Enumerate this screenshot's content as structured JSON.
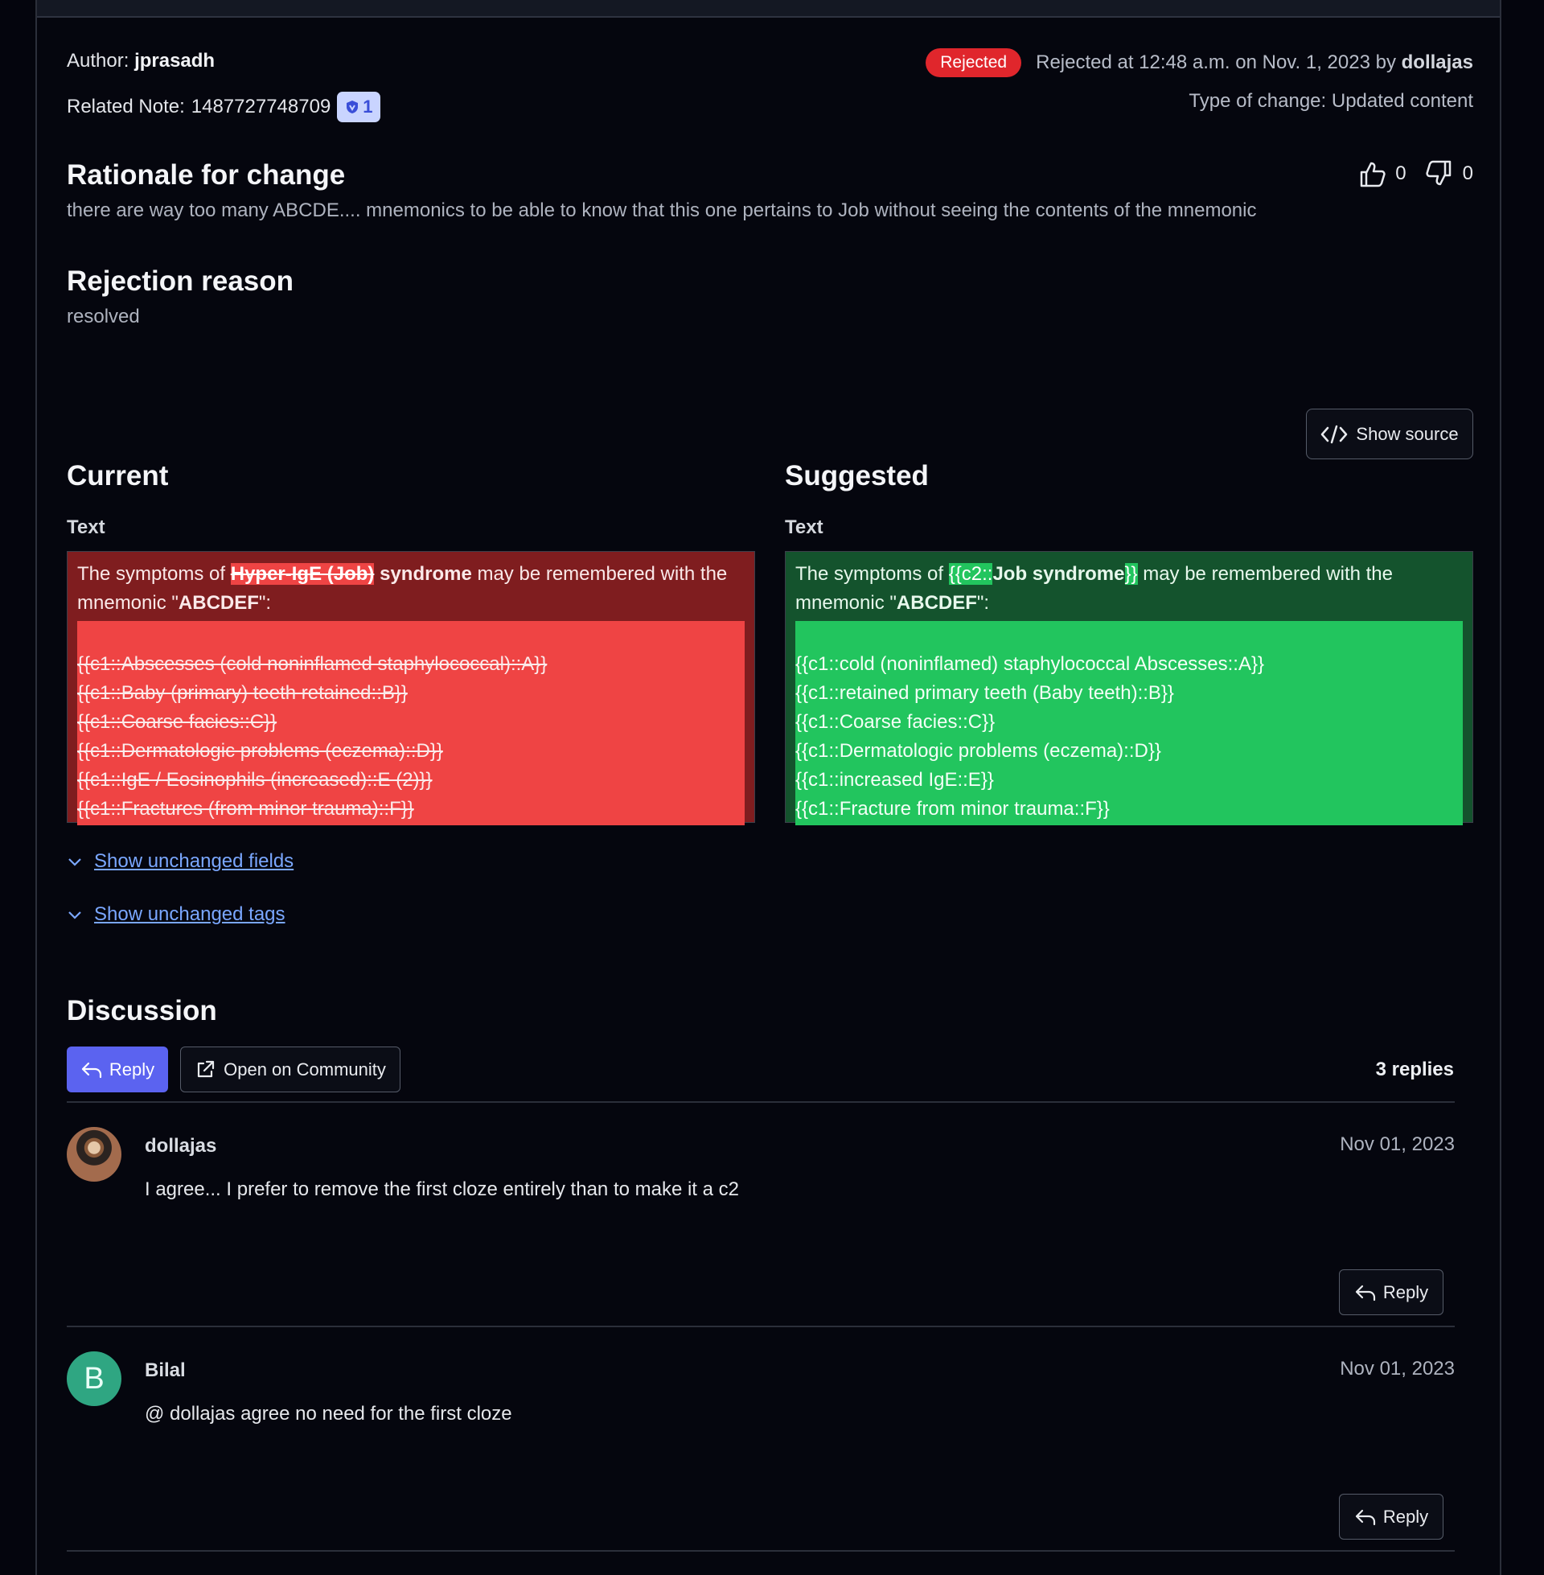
{
  "header": {
    "author_label": "Author:",
    "author_name": "jprasadh",
    "related_label": "Related Note:",
    "related_id": "1487727748709",
    "related_badge_count": "1",
    "status_badge": "Rejected",
    "status_text_prefix": "Rejected at 12:48 a.m. on Nov. 1, 2023 by",
    "status_user": "dollajas",
    "type_of_change": "Type of change: Updated content"
  },
  "rationale": {
    "title": "Rationale for change",
    "text": "there are way too many ABCDE.... mnemonics to be able to know that this one pertains to Job without seeing the contents of the mnemonic",
    "upvotes": "0",
    "downvotes": "0"
  },
  "rejection": {
    "title": "Rejection reason",
    "text": "resolved"
  },
  "diff": {
    "show_source_label": "Show source",
    "current": {
      "title": "Current",
      "field_label": "Text",
      "intro_prefix": "The symptoms of ",
      "removed_part": "Hyper-IgE (Job)",
      "intro_bold": " syndrome",
      "intro_suffix": " may be remembered with the mnemonic \"",
      "mnemonic": "ABCDEF",
      "intro_end": "\":",
      "lines": [
        "{{c1::Abscesses (cold noninflamed staphylococcal)::A}}",
        "{{c1::Baby (primary) teeth retained::B}}",
        "{{c1::Coarse facies::C}}",
        "{{c1::Dermatologic problems (eczema)::D}}",
        "{{c1::IgE / Eosinophils (increased)::E (2)}}",
        "{{c1::Fractures (from minor trauma)::F}}"
      ]
    },
    "suggested": {
      "title": "Suggested",
      "field_label": "Text",
      "intro_prefix": "The symptoms of ",
      "added_open": "{{c2::",
      "intro_bold": "Job syndrome",
      "added_close": "}}",
      "intro_suffix": " may be remembered with the mnemonic \"",
      "mnemonic": "ABCDEF",
      "intro_end": "\":",
      "lines": [
        "{{c1::cold (noninflamed) staphylococcal Abscesses::A}}",
        "{{c1::retained primary teeth (Baby teeth)::B}}",
        "{{c1::Coarse facies::C}}",
        "{{c1::Dermatologic problems (eczema)::D}}",
        "{{c1::increased IgE::E}}",
        "{{c1::Fracture from minor trauma::F}}"
      ]
    },
    "show_unchanged_fields": "Show unchanged fields",
    "show_unchanged_tags": "Show unchanged tags"
  },
  "discussion": {
    "title": "Discussion",
    "reply_label": "Reply",
    "open_label": "Open on Community",
    "replies_count": "3 replies",
    "comments": [
      {
        "author": "dollajas",
        "date": "Nov 01, 2023",
        "text": "I agree... I prefer to remove the first cloze entirely than to make it a c2",
        "reply_label": "Reply"
      },
      {
        "author": "Bilal",
        "avatar_letter": "B",
        "date": "Nov 01, 2023",
        "text": "@ dollajas agree no need for the first cloze",
        "reply_label": "Reply"
      }
    ]
  },
  "colors": {
    "accent": "#5b63f0",
    "rejected": "#e0262c",
    "removed_bg": "#7f1d1f",
    "added_bg": "#14532d",
    "link": "#7aa7ff"
  }
}
